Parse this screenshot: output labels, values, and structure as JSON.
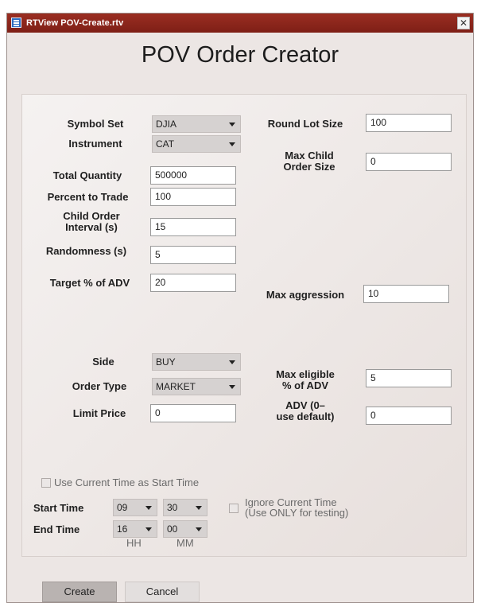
{
  "window": {
    "title": "RTView POV-Create.rtv",
    "close_glyph": "✕",
    "header": "POV Order Creator"
  },
  "form": {
    "symbol_set": {
      "label": "Symbol Set",
      "value": "DJIA"
    },
    "instrument": {
      "label": "Instrument",
      "value": "CAT"
    },
    "total_quantity": {
      "label": "Total Quantity",
      "value": "500000"
    },
    "percent_to_trade": {
      "label": "Percent to Trade",
      "value": "100"
    },
    "child_order_interval": {
      "label_line1": "Child Order",
      "label_line2": "Interval (s)",
      "value": "15"
    },
    "randomness": {
      "label": "Randomness (s)",
      "value": "5"
    },
    "target_pct_adv": {
      "label": "Target % of ADV",
      "value": "20"
    },
    "round_lot_size": {
      "label": "Round Lot Size",
      "value": "100"
    },
    "max_child_order_size": {
      "label_line1": "Max Child",
      "label_line2": "Order Size",
      "value": "0"
    },
    "max_aggression": {
      "label": "Max aggression",
      "value": "10"
    },
    "side": {
      "label": "Side",
      "value": "BUY"
    },
    "order_type": {
      "label": "Order Type",
      "value": "MARKET"
    },
    "limit_price": {
      "label": "Limit Price",
      "value": "0"
    },
    "max_eligible_pct_adv": {
      "label_line1": "Max eligible",
      "label_line2": "% of ADV",
      "value": "5"
    },
    "adv": {
      "label_line1": "ADV (0–",
      "label_line2": "use default)",
      "value": "0"
    },
    "use_current_time": {
      "label": "Use Current Time as Start Time"
    },
    "start_time": {
      "label": "Start Time",
      "hh": "09",
      "mm": "30"
    },
    "end_time": {
      "label": "End Time",
      "hh": "16",
      "mm": "00"
    },
    "hh_label": "HH",
    "mm_label": "MM",
    "ignore_current_time": {
      "label_line1": "Ignore Current Time",
      "label_line2": "(Use ONLY for testing)"
    }
  },
  "buttons": {
    "create": "Create",
    "cancel": "Cancel"
  }
}
